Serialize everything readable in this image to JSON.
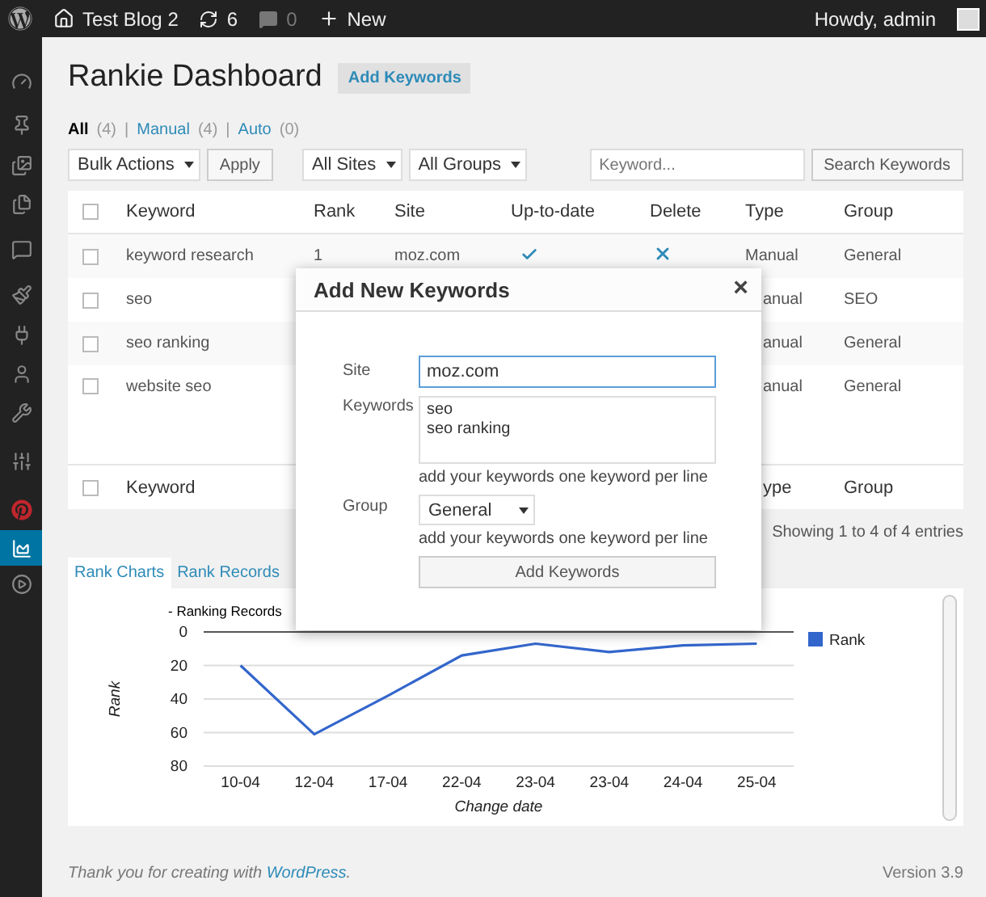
{
  "admin_bar": {
    "site": "Test Blog 2",
    "updates": "6",
    "comments": "0",
    "new": "New",
    "greeting": "Howdy, admin"
  },
  "sidebar": {
    "items": [
      {
        "selected": false
      },
      {
        "selected": false
      },
      {
        "selected": false
      },
      {
        "selected": false
      },
      {
        "selected": false
      },
      {
        "selected": false
      },
      {
        "selected": false
      },
      {
        "selected": false
      },
      {
        "selected": false
      },
      {
        "selected": false
      },
      {
        "selected": false
      },
      {
        "selected": true
      },
      {
        "selected": false
      }
    ]
  },
  "page": {
    "title": "Rankie Dashboard",
    "add_button": "Add Keywords"
  },
  "filters": [
    {
      "label": "All",
      "count": "(4)",
      "selected": true
    },
    {
      "separator": "|",
      "label": "Manual",
      "count": "(4)",
      "selected": false
    },
    {
      "separator": "|",
      "label": "Auto",
      "count": "(0)",
      "selected": false
    }
  ],
  "toolbar": {
    "bulk_actions": "Bulk Actions",
    "apply": "Apply",
    "sites": "All Sites",
    "groups": "All Groups",
    "search_placeholder": "Keyword...",
    "search_button": "Search Keywords"
  },
  "table": {
    "select_all_checked": false,
    "columns": [
      "Keyword",
      "Rank",
      "Site",
      "Up-to-date",
      "Delete",
      "Type",
      "Group"
    ],
    "rows": [
      {
        "checked": false,
        "keyword": "keyword research",
        "rank": "1",
        "site": "moz.com",
        "up_to_date": true,
        "type": "Manual",
        "group": "General"
      },
      {
        "checked": false,
        "keyword": "seo",
        "type": "anual",
        "group": "SEO"
      },
      {
        "checked": false,
        "keyword": "seo ranking",
        "type": "anual",
        "group": "General"
      },
      {
        "checked": false,
        "keyword": "website seo",
        "type": "anual",
        "group": "General"
      }
    ],
    "footer": {
      "checked": false,
      "keyword": "Keyword",
      "type": "ype",
      "group": "Group"
    },
    "info": "Showing 1 to 4 of 4 entries"
  },
  "tabs": [
    {
      "label": "Rank Charts",
      "selected": true
    },
    {
      "label": "Rank Records",
      "selected": false
    }
  ],
  "chart_data": {
    "type": "line",
    "title": "- Ranking Records",
    "xlabel": "Change date",
    "ylabel": "Rank",
    "categories": [
      "10-04",
      "12-04",
      "17-04",
      "22-04",
      "23-04",
      "23-04",
      "24-04",
      "25-04"
    ],
    "series": [
      {
        "name": "Rank",
        "color": "#3366cc",
        "values": [
          20,
          61,
          38,
          14,
          7,
          12,
          8,
          7
        ]
      }
    ],
    "grid": true,
    "ylim": [
      80,
      0
    ],
    "yticks": [
      0,
      20,
      40,
      60,
      80
    ]
  },
  "dialog": {
    "title": "Add New Keywords",
    "close": "×",
    "site_label": "Site",
    "site_value": "moz.com",
    "keywords_label": "Keywords",
    "keywords_value": "seo\nseo ranking",
    "keywords_hint": "add your keywords one keyword per line",
    "group_label": "Group",
    "group_value": "General",
    "group_hint": "add your keywords one keyword per line",
    "submit": "Add Keywords"
  },
  "footer": {
    "thanks": "Thank you for creating with",
    "link": "WordPress",
    "period": ".",
    "version": "Version 3.9"
  }
}
